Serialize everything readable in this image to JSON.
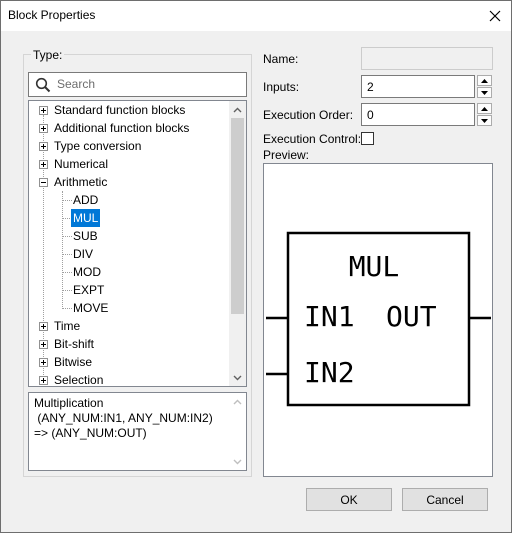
{
  "window": {
    "title": "Block Properties",
    "close_icon": "close-icon"
  },
  "type_group": {
    "label": "Type:",
    "search": {
      "placeholder": "Search",
      "value": "",
      "icon": "search-icon"
    },
    "tree": [
      {
        "label": "Standard function blocks",
        "expanded": false
      },
      {
        "label": "Additional function blocks",
        "expanded": false
      },
      {
        "label": "Type conversion",
        "expanded": false
      },
      {
        "label": "Numerical",
        "expanded": false
      },
      {
        "label": "Arithmetic",
        "expanded": true,
        "children": [
          {
            "label": "ADD",
            "selected": false
          },
          {
            "label": "MUL",
            "selected": true
          },
          {
            "label": "SUB",
            "selected": false
          },
          {
            "label": "DIV",
            "selected": false
          },
          {
            "label": "MOD",
            "selected": false
          },
          {
            "label": "EXPT",
            "selected": false
          },
          {
            "label": "MOVE",
            "selected": false
          }
        ]
      },
      {
        "label": "Time",
        "expanded": false
      },
      {
        "label": "Bit-shift",
        "expanded": false
      },
      {
        "label": "Bitwise",
        "expanded": false
      },
      {
        "label": "Selection",
        "expanded": false
      }
    ],
    "description": "Multiplication\n (ANY_NUM:IN1, ANY_NUM:IN2)\n=> (ANY_NUM:OUT)"
  },
  "properties": {
    "name_label": "Name:",
    "name_value": "",
    "inputs_label": "Inputs:",
    "inputs_value": "2",
    "execution_order_label": "Execution Order:",
    "execution_order_value": "0",
    "execution_control_label": "Execution Control:",
    "execution_control_checked": false,
    "preview_label": "Preview:"
  },
  "preview_block": {
    "type_name": "MUL",
    "inputs": [
      "IN1",
      "IN2"
    ],
    "outputs": [
      "OUT"
    ]
  },
  "buttons": {
    "ok": "OK",
    "cancel": "Cancel"
  }
}
